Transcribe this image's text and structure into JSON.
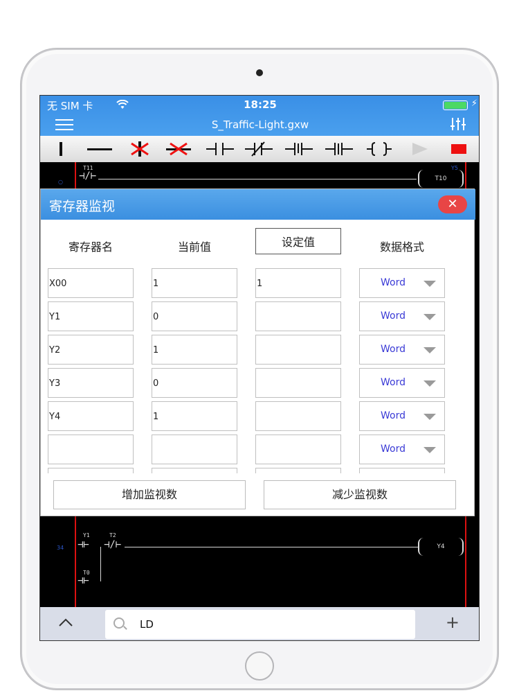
{
  "status": {
    "carrier": "无 SIM 卡",
    "time": "18:25"
  },
  "nav": {
    "file_title": "S_Traffic-Light.gxw"
  },
  "toolbar": {
    "tools": [
      "vertical-line",
      "horizontal-line",
      "delete-vertical",
      "delete-horizontal",
      "contact-no",
      "contact-nc",
      "contact-rising",
      "contact-falling",
      "function-block",
      "run",
      "stop"
    ]
  },
  "ladder": {
    "top_row": {
      "contact_label": "T11",
      "coil_label": "T10",
      "rung_label": "Y5"
    },
    "bottom_row": {
      "contact1": "Y1",
      "contact2": "T2",
      "contact3": "T0",
      "coil_label": "Y4",
      "rung_step": "34"
    }
  },
  "dialog": {
    "title": "寄存器监视",
    "close": "✕",
    "headers": {
      "name": "寄存器名",
      "current": "当前值",
      "setpoint": "设定值",
      "format": "数据格式"
    },
    "rows": [
      {
        "name": "X00",
        "current": "1",
        "setpoint": "1",
        "format": "Word"
      },
      {
        "name": "Y1",
        "current": "0",
        "setpoint": "",
        "format": "Word"
      },
      {
        "name": "Y2",
        "current": "1",
        "setpoint": "",
        "format": "Word"
      },
      {
        "name": "Y3",
        "current": "0",
        "setpoint": "",
        "format": "Word"
      },
      {
        "name": "Y4",
        "current": "1",
        "setpoint": "",
        "format": "Word"
      },
      {
        "name": "",
        "current": "",
        "setpoint": "",
        "format": "Word"
      }
    ],
    "add_button": "增加监视数",
    "remove_button": "减少监视数"
  },
  "bottom": {
    "search_value": "LD",
    "plus": "+"
  }
}
